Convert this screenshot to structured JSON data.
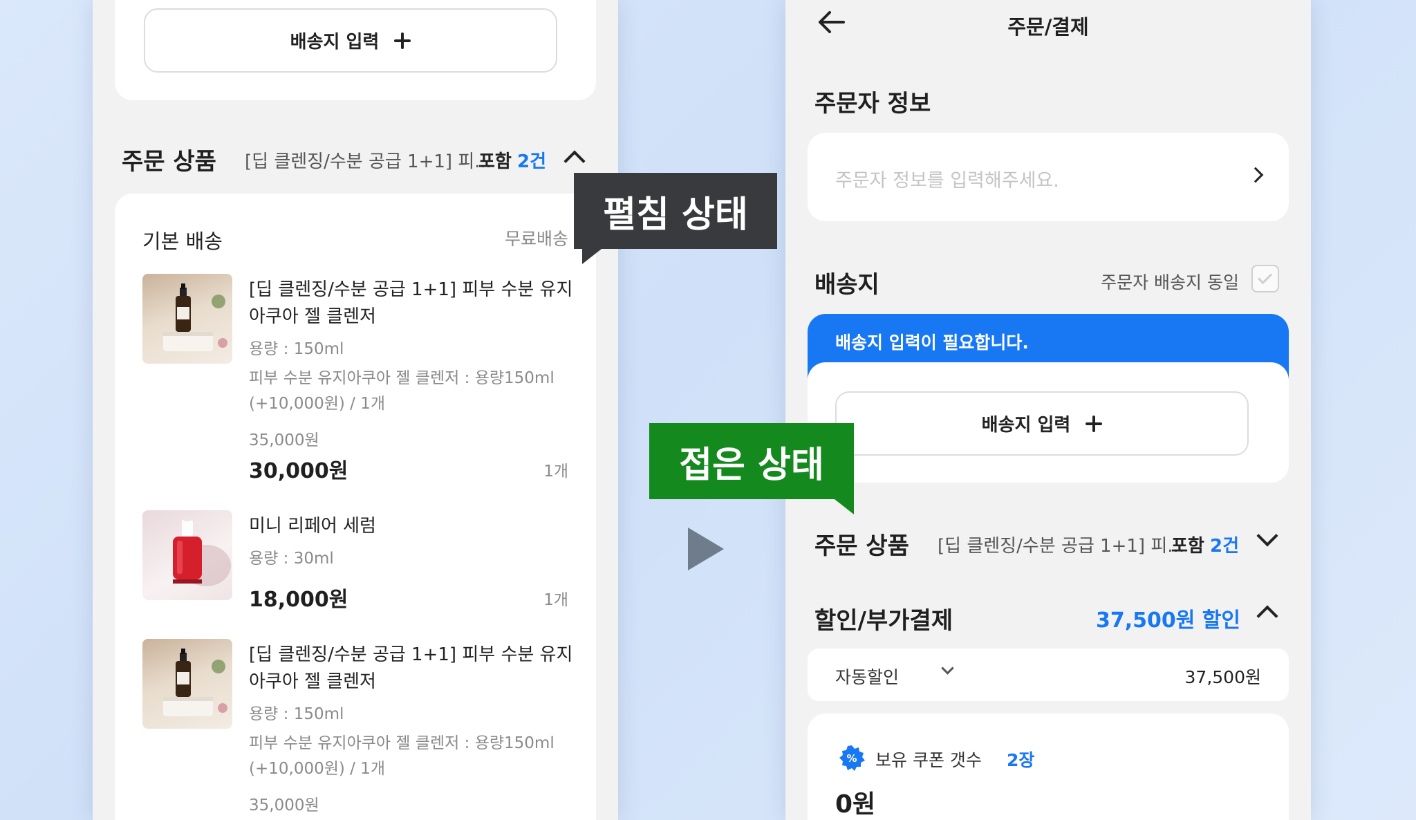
{
  "left": {
    "address_button_label": "배송지 입력",
    "order_products": {
      "title": "주문 상품",
      "summary": "[딥 클렌징/수분 공급 1+1] 피...",
      "included_label": "포함",
      "included_count": "2건"
    },
    "shipping": {
      "label": "기본 배송",
      "fee": "무료배송"
    },
    "items": [
      {
        "name_line1": "[딥 클렌징/수분 공급 1+1] 피부 수분 유지",
        "name_line2": "아쿠아 젤 클렌저",
        "capacity": "용량 : 150ml",
        "option_line1": "피부 수분 유지아쿠아 젤 클렌저 : 용량150ml",
        "option_line2": "(+10,000원) / 1개",
        "original_price": "35,000원",
        "price": "30,000원",
        "qty": "1개"
      },
      {
        "name_line1": "미니 리페어 세럼",
        "capacity": "용량 : 30ml",
        "price": "18,000원",
        "qty": "1개"
      },
      {
        "name_line1": "[딥 클렌징/수분 공급 1+1] 피부 수분 유지",
        "name_line2": "아쿠아 젤 클렌저",
        "capacity": "용량 : 150ml",
        "option_line1": "피부 수분 유지아쿠아 젤 클렌저 : 용량150ml",
        "option_line2": "(+10,000원) / 1개",
        "original_price": "35,000원"
      }
    ]
  },
  "tags": {
    "expanded": "펼침 상태",
    "collapsed": "접은 상태"
  },
  "right": {
    "header_title": "주문/결제",
    "orderer": {
      "title": "주문자 정보",
      "placeholder": "주문자 정보를 입력해주세요."
    },
    "delivery": {
      "title": "배송지",
      "same_label": "주문자 배송지 동일",
      "banner": "배송지 입력이 필요합니다.",
      "button_label": "배송지 입력"
    },
    "order_products": {
      "title": "주문 상품",
      "summary": "[딥 클렌징/수분 공급 1+1] 피...",
      "included_label": "포함",
      "included_count": "2건"
    },
    "discount": {
      "title": "할인/부가결제",
      "total": "37,500원 할인",
      "auto_label": "자동할인",
      "auto_amount": "37,500원",
      "coupon_label": "보유 쿠폰 갯수",
      "coupon_count": "2장",
      "coupon_amount": "0원"
    }
  },
  "colors": {
    "accent_blue": "#1877f2",
    "tag_dark": "#383a3d",
    "tag_green": "#14891e"
  }
}
